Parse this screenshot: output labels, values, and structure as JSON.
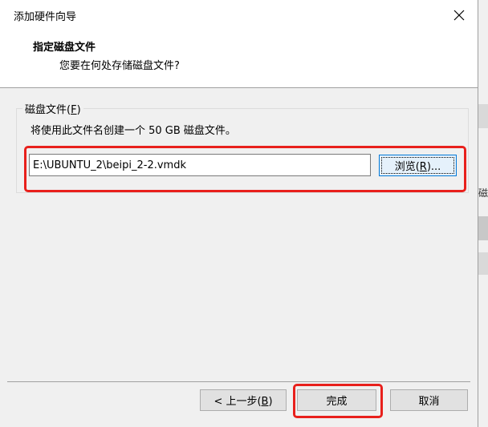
{
  "window": {
    "title": "添加硬件向导",
    "close_symbol": "✕"
  },
  "header": {
    "title": "指定磁盘文件",
    "subtitle": "您要在何处存储磁盘文件?"
  },
  "disk_file_group": {
    "label_prefix": "磁盘文件(",
    "label_mnemonic": "F",
    "label_suffix": ")",
    "description": "将使用此文件名创建一个 50 GB 磁盘文件。",
    "path_value": "E:\\UBUNTU_2\\beipi_2-2.vmdk",
    "browse_prefix": "浏览(",
    "browse_mnemonic": "R",
    "browse_suffix": ")..."
  },
  "footer": {
    "back_prefix": "< 上一步(",
    "back_mnemonic": "B",
    "back_suffix": ")",
    "finish_label": "完成",
    "cancel_label": "取消"
  },
  "background_app": {
    "glyph": "磁"
  },
  "colors": {
    "highlight": "#e8201c",
    "focus_border": "#0078d7",
    "dialog_bg": "#f0f0f0"
  }
}
